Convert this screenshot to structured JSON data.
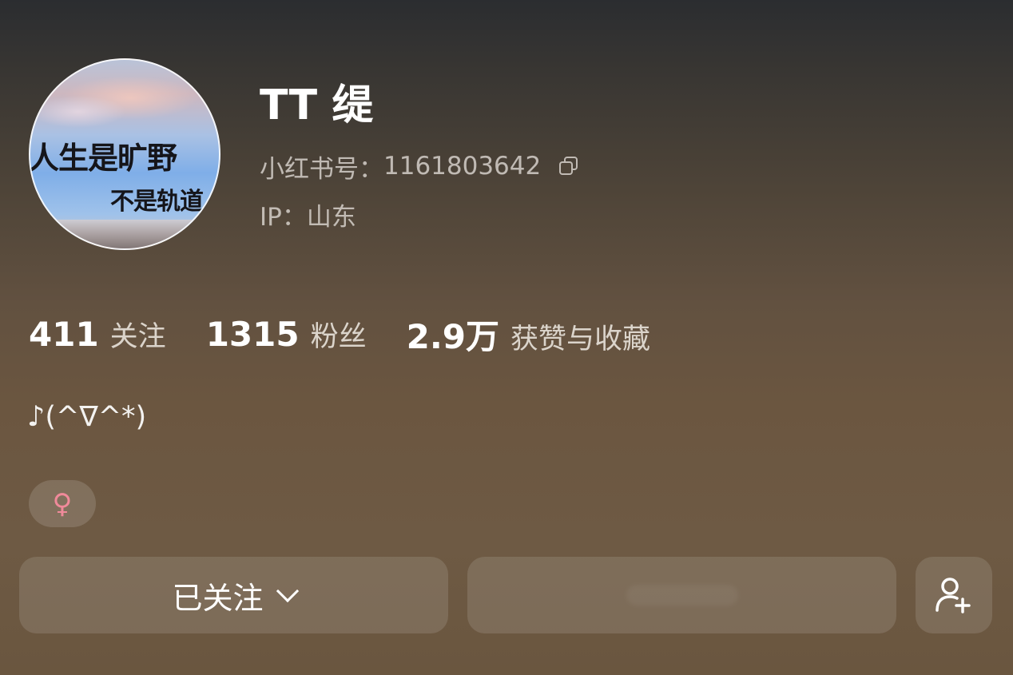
{
  "profile": {
    "avatar_text_line1": "人生是旷野",
    "avatar_text_line2": "不是轨道",
    "name": "TT 缇",
    "redid_label": "小红书号：",
    "redid_value": "1161803642",
    "ip_label": "IP：",
    "ip_value": "山东"
  },
  "stats": [
    {
      "value": "411",
      "label": "关注"
    },
    {
      "value": "1315",
      "label": "粉丝"
    },
    {
      "value": "2.9万",
      "label": "获赞与收藏"
    }
  ],
  "bio": "♪(^∇^*)",
  "gender_symbol": "♀",
  "actions": {
    "follow_label": "已关注"
  },
  "icons": {
    "copy": "copy-icon",
    "chevron": "chevron-down-icon",
    "add_friend": "add-user-icon"
  },
  "colors": {
    "gender_female": "#f08a9a"
  }
}
